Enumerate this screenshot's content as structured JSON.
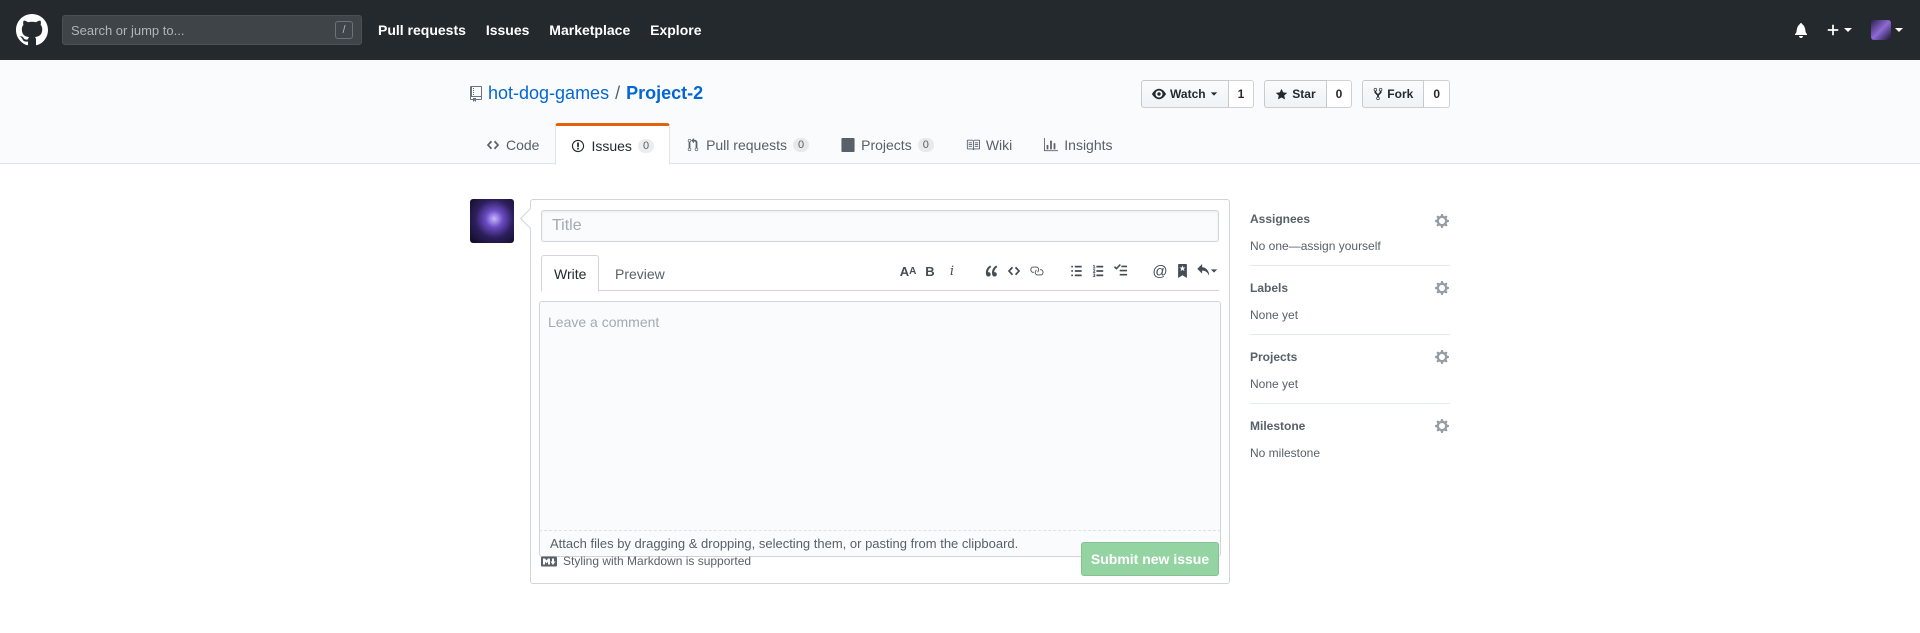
{
  "header": {
    "search_placeholder": "Search or jump to...",
    "search_shortcut": "/",
    "nav": [
      "Pull requests",
      "Issues",
      "Marketplace",
      "Explore"
    ]
  },
  "repo": {
    "owner": "hot-dog-games",
    "separator": "/",
    "name": "Project-2",
    "watch_label": "Watch",
    "watch_count": "1",
    "star_label": "Star",
    "star_count": "0",
    "fork_label": "Fork",
    "fork_count": "0",
    "tabs": [
      {
        "label": "Code",
        "count": null
      },
      {
        "label": "Issues",
        "count": "0"
      },
      {
        "label": "Pull requests",
        "count": "0"
      },
      {
        "label": "Projects",
        "count": "0"
      },
      {
        "label": "Wiki",
        "count": null
      },
      {
        "label": "Insights",
        "count": null
      }
    ]
  },
  "form": {
    "title_placeholder": "Title",
    "write_tab": "Write",
    "preview_tab": "Preview",
    "comment_placeholder": "Leave a comment",
    "attach_text": "Attach files by dragging & dropping, selecting them, or pasting from the clipboard.",
    "markdown_text": "Styling with Markdown is supported",
    "submit_label": "Submit new issue"
  },
  "sidebar": [
    {
      "label": "Assignees",
      "value": "No one—assign yourself"
    },
    {
      "label": "Labels",
      "value": "None yet"
    },
    {
      "label": "Projects",
      "value": "None yet"
    },
    {
      "label": "Milestone",
      "value": "No milestone"
    }
  ],
  "colors": {
    "header_bg": "#24292e",
    "accent_tab": "#e36209",
    "link": "#0366d6",
    "submit_disabled": "#94d3a2"
  }
}
